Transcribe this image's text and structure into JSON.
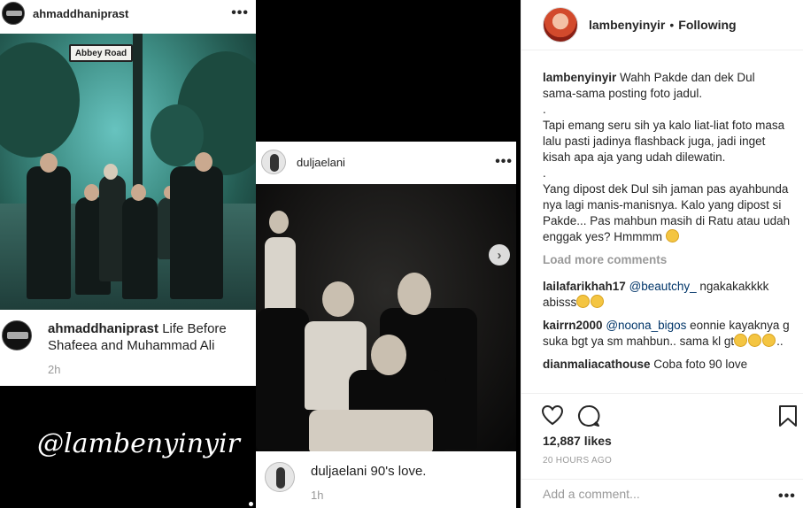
{
  "card1": {
    "username": "ahmaddhaniprast",
    "menu": "•••",
    "sign_text": "Abbey Road",
    "caption_user": "ahmaddhaniprast",
    "caption_text": " Life Before Shafeea and Muhammad Ali",
    "time": "2h"
  },
  "watermark": "@lambenyinyir",
  "card2": {
    "username": "duljaelani",
    "menu": "•••",
    "next": "›",
    "caption_user": "duljaelani",
    "caption_text": " 90's love.",
    "time": "1h"
  },
  "panel": {
    "username": "lambenyinyir",
    "separator": "•",
    "follow_status": "Following",
    "caption": {
      "user": "lambenyinyir",
      "lines": [
        "Wahh Pakde dan dek Dul sama-sama posting foto jadul.",
        ".",
        "Tapi emang seru sih ya kalo liat-liat foto masa lalu pasti jadinya flashback juga, jadi inget kisah apa aja yang udah dilewatin.",
        ".",
        "Yang dipost dek Dul sih jaman pas ayahbunda nya lagi manis-manisnya. Kalo yang dipost si Pakde... Pas mahbun masih di Ratu atau udah enggak yes? Hmmmm"
      ]
    },
    "load_more": "Load more comments",
    "comments": [
      {
        "user": "lailafarikhah17",
        "mention": "@beautchy_",
        "text": " ngakakakkkk abisss"
      },
      {
        "user": "kairrn2000",
        "mention": "@noona_bigos",
        "text": " eonnie kayaknya g suka bgt ya sm mahbun.. sama kl gt",
        "suffix": ".."
      },
      {
        "user": "dianmaliacathouse",
        "mention": "",
        "text": " Coba foto 90 love"
      }
    ],
    "likes": "12,887 likes",
    "date": "20 HOURS AGO",
    "add_placeholder": "Add a comment...",
    "add_menu": "•••"
  },
  "icons": [
    "heart-icon",
    "comment-icon",
    "bookmark-icon",
    "chevron-right-icon",
    "more-icon"
  ]
}
